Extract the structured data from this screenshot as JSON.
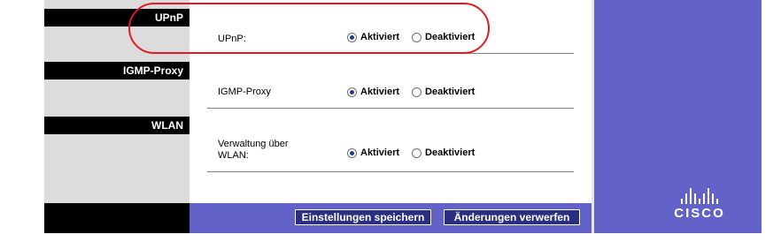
{
  "sections": [
    {
      "header": "UPnP",
      "label": "UPnP:",
      "enabled_label": "Aktiviert",
      "disabled_label": "Deaktiviert",
      "selected": "Aktiviert"
    },
    {
      "header": "IGMP-Proxy",
      "label": "IGMP-Proxy",
      "enabled_label": "Aktiviert",
      "disabled_label": "Deaktiviert",
      "selected": "Aktiviert"
    },
    {
      "header": "WLAN",
      "label": "Verwaltung über WLAN:",
      "enabled_label": "Aktiviert",
      "disabled_label": "Deaktiviert",
      "selected": "Aktiviert"
    }
  ],
  "buttons": {
    "save": "Einstellungen speichern",
    "discard": "Änderungen verwerfen"
  },
  "logo": {
    "text": "CISCO",
    "icon": "cisco-bars-icon"
  },
  "colors": {
    "accent": "#6262c8",
    "annotation": "#e21b23"
  }
}
